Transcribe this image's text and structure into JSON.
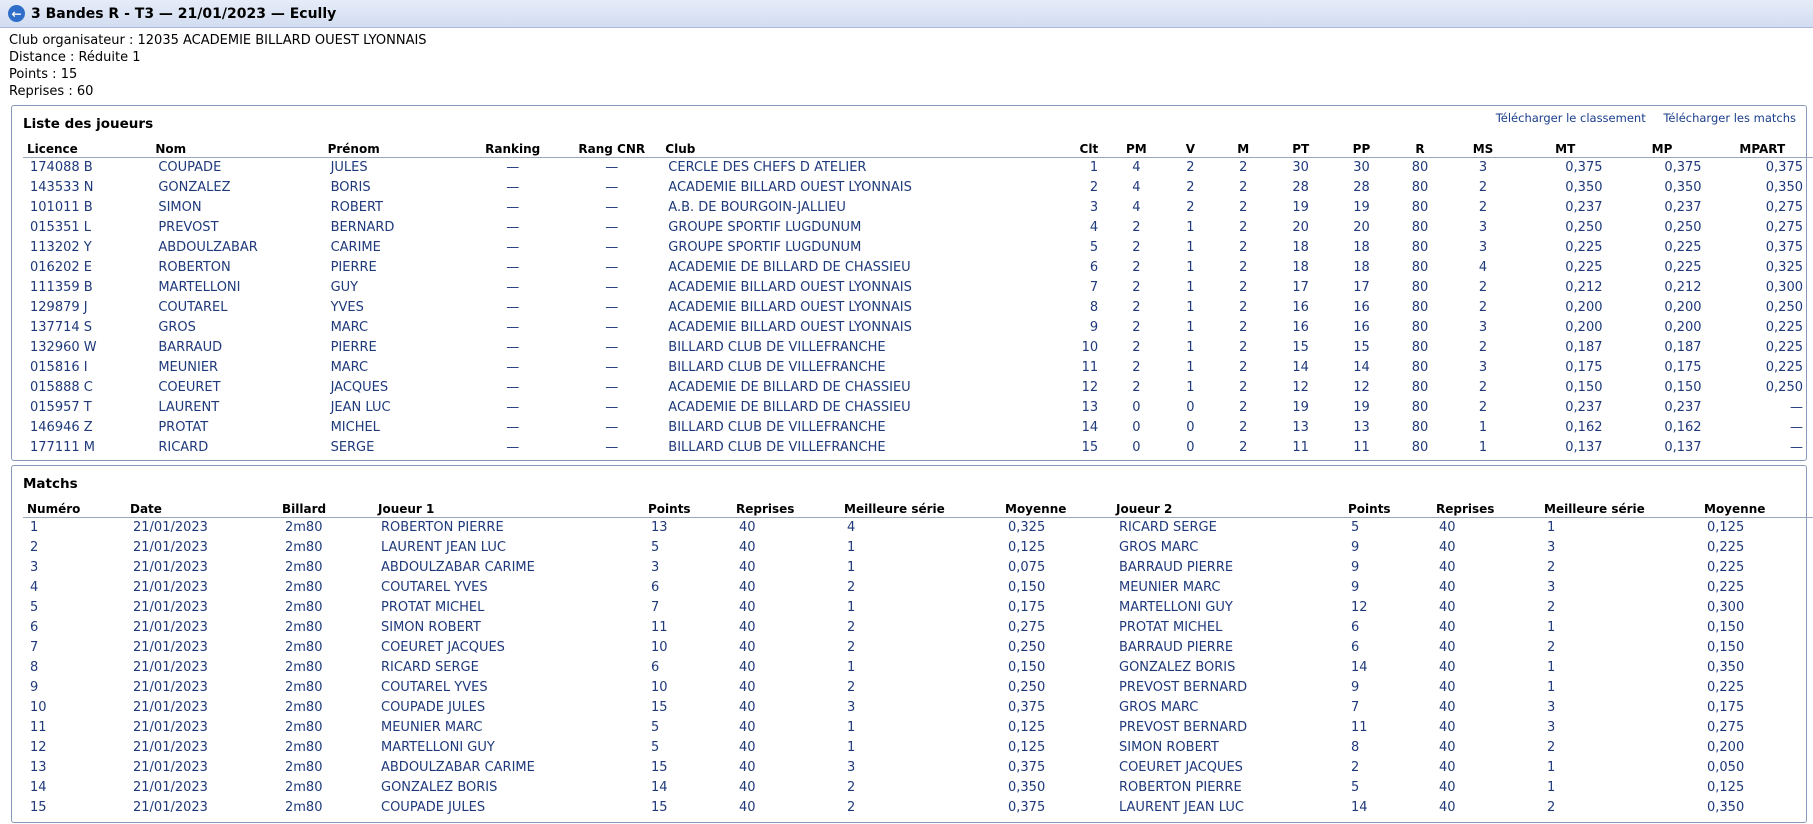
{
  "header": {
    "title": "3 Bandes R - T3 — 21/01/2023 — Ecully"
  },
  "info": [
    "Club organisateur : 12035 ACADEMIE BILLARD OUEST LYONNAIS",
    "Distance : Réduite 1",
    "Points : 15",
    "Reprises : 60"
  ],
  "players": {
    "title": "Liste des joueurs",
    "download_ranking": "Télécharger le classement",
    "download_matches": "Télécharger les matchs",
    "columns": [
      "Licence",
      "Nom",
      "Prénom",
      "Ranking",
      "Rang CNR",
      "Club",
      "Clt",
      "PM",
      "V",
      "M",
      "PT",
      "PP",
      "R",
      "MS",
      "MT",
      "MP",
      "MPART"
    ],
    "rows": [
      [
        "174088 B",
        "COUPADE",
        "JULES",
        "—",
        "—",
        "CERCLE DES CHEFS D ATELIER",
        "1",
        "4",
        "2",
        "2",
        "30",
        "30",
        "80",
        "3",
        "0,375",
        "0,375",
        "0,375"
      ],
      [
        "143533 N",
        "GONZALEZ",
        "BORIS",
        "—",
        "—",
        "ACADEMIE BILLARD OUEST LYONNAIS",
        "2",
        "4",
        "2",
        "2",
        "28",
        "28",
        "80",
        "2",
        "0,350",
        "0,350",
        "0,350"
      ],
      [
        "101011 B",
        "SIMON",
        "ROBERT",
        "—",
        "—",
        "A.B. DE BOURGOIN-JALLIEU",
        "3",
        "4",
        "2",
        "2",
        "19",
        "19",
        "80",
        "2",
        "0,237",
        "0,237",
        "0,275"
      ],
      [
        "015351 L",
        "PREVOST",
        "BERNARD",
        "—",
        "—",
        "GROUPE SPORTIF LUGDUNUM",
        "4",
        "2",
        "1",
        "2",
        "20",
        "20",
        "80",
        "3",
        "0,250",
        "0,250",
        "0,275"
      ],
      [
        "113202 Y",
        "ABDOULZABAR",
        "CARIME",
        "—",
        "—",
        "GROUPE SPORTIF LUGDUNUM",
        "5",
        "2",
        "1",
        "2",
        "18",
        "18",
        "80",
        "3",
        "0,225",
        "0,225",
        "0,375"
      ],
      [
        "016202 E",
        "ROBERTON",
        "PIERRE",
        "—",
        "—",
        "ACADEMIE DE BILLARD DE CHASSIEU",
        "6",
        "2",
        "1",
        "2",
        "18",
        "18",
        "80",
        "4",
        "0,225",
        "0,225",
        "0,325"
      ],
      [
        "111359 B",
        "MARTELLONI",
        "GUY",
        "—",
        "—",
        "ACADEMIE BILLARD OUEST LYONNAIS",
        "7",
        "2",
        "1",
        "2",
        "17",
        "17",
        "80",
        "2",
        "0,212",
        "0,212",
        "0,300"
      ],
      [
        "129879 J",
        "COUTAREL",
        "YVES",
        "—",
        "—",
        "ACADEMIE BILLARD OUEST LYONNAIS",
        "8",
        "2",
        "1",
        "2",
        "16",
        "16",
        "80",
        "2",
        "0,200",
        "0,200",
        "0,250"
      ],
      [
        "137714 S",
        "GROS",
        "MARC",
        "—",
        "—",
        "ACADEMIE BILLARD OUEST LYONNAIS",
        "9",
        "2",
        "1",
        "2",
        "16",
        "16",
        "80",
        "3",
        "0,200",
        "0,200",
        "0,225"
      ],
      [
        "132960 W",
        "BARRAUD",
        "PIERRE",
        "—",
        "—",
        "BILLARD CLUB DE VILLEFRANCHE",
        "10",
        "2",
        "1",
        "2",
        "15",
        "15",
        "80",
        "2",
        "0,187",
        "0,187",
        "0,225"
      ],
      [
        "015816 I",
        "MEUNIER",
        "MARC",
        "—",
        "—",
        "BILLARD CLUB DE VILLEFRANCHE",
        "11",
        "2",
        "1",
        "2",
        "14",
        "14",
        "80",
        "3",
        "0,175",
        "0,175",
        "0,225"
      ],
      [
        "015888 C",
        "COEURET",
        "JACQUES",
        "—",
        "—",
        "ACADEMIE DE BILLARD DE CHASSIEU",
        "12",
        "2",
        "1",
        "2",
        "12",
        "12",
        "80",
        "2",
        "0,150",
        "0,150",
        "0,250"
      ],
      [
        "015957 T",
        "LAURENT",
        "JEAN LUC",
        "—",
        "—",
        "ACADEMIE DE BILLARD DE CHASSIEU",
        "13",
        "0",
        "0",
        "2",
        "19",
        "19",
        "80",
        "2",
        "0,237",
        "0,237",
        "—"
      ],
      [
        "146946 Z",
        "PROTAT",
        "MICHEL",
        "—",
        "—",
        "BILLARD CLUB DE VILLEFRANCHE",
        "14",
        "0",
        "0",
        "2",
        "13",
        "13",
        "80",
        "1",
        "0,162",
        "0,162",
        "—"
      ],
      [
        "177111 M",
        "RICARD",
        "SERGE",
        "—",
        "—",
        "BILLARD CLUB DE VILLEFRANCHE",
        "15",
        "0",
        "0",
        "2",
        "11",
        "11",
        "80",
        "1",
        "0,137",
        "0,137",
        "—"
      ]
    ]
  },
  "matches": {
    "title": "Matchs",
    "columns": [
      "Numéro",
      "Date",
      "Billard",
      "Joueur 1",
      "Points",
      "Reprises",
      "Meilleure série",
      "Moyenne",
      "Joueur 2",
      "Points",
      "Reprises",
      "Meilleure série",
      "Moyenne"
    ],
    "rows": [
      [
        "1",
        "21/01/2023",
        "2m80",
        "ROBERTON PIERRE",
        "13",
        "40",
        "4",
        "0,325",
        "RICARD SERGE",
        "5",
        "40",
        "1",
        "0,125"
      ],
      [
        "2",
        "21/01/2023",
        "2m80",
        "LAURENT JEAN LUC",
        "5",
        "40",
        "1",
        "0,125",
        "GROS MARC",
        "9",
        "40",
        "3",
        "0,225"
      ],
      [
        "3",
        "21/01/2023",
        "2m80",
        "ABDOULZABAR CARIME",
        "3",
        "40",
        "1",
        "0,075",
        "BARRAUD PIERRE",
        "9",
        "40",
        "2",
        "0,225"
      ],
      [
        "4",
        "21/01/2023",
        "2m80",
        "COUTAREL YVES",
        "6",
        "40",
        "2",
        "0,150",
        "MEUNIER MARC",
        "9",
        "40",
        "3",
        "0,225"
      ],
      [
        "5",
        "21/01/2023",
        "2m80",
        "PROTAT MICHEL",
        "7",
        "40",
        "1",
        "0,175",
        "MARTELLONI GUY",
        "12",
        "40",
        "2",
        "0,300"
      ],
      [
        "6",
        "21/01/2023",
        "2m80",
        "SIMON ROBERT",
        "11",
        "40",
        "2",
        "0,275",
        "PROTAT MICHEL",
        "6",
        "40",
        "1",
        "0,150"
      ],
      [
        "7",
        "21/01/2023",
        "2m80",
        "COEURET JACQUES",
        "10",
        "40",
        "2",
        "0,250",
        "BARRAUD PIERRE",
        "6",
        "40",
        "2",
        "0,150"
      ],
      [
        "8",
        "21/01/2023",
        "2m80",
        "RICARD SERGE",
        "6",
        "40",
        "1",
        "0,150",
        "GONZALEZ BORIS",
        "14",
        "40",
        "1",
        "0,350"
      ],
      [
        "9",
        "21/01/2023",
        "2m80",
        "COUTAREL YVES",
        "10",
        "40",
        "2",
        "0,250",
        "PREVOST BERNARD",
        "9",
        "40",
        "1",
        "0,225"
      ],
      [
        "10",
        "21/01/2023",
        "2m80",
        "COUPADE JULES",
        "15",
        "40",
        "3",
        "0,375",
        "GROS MARC",
        "7",
        "40",
        "3",
        "0,175"
      ],
      [
        "11",
        "21/01/2023",
        "2m80",
        "MEUNIER MARC",
        "5",
        "40",
        "1",
        "0,125",
        "PREVOST BERNARD",
        "11",
        "40",
        "3",
        "0,275"
      ],
      [
        "12",
        "21/01/2023",
        "2m80",
        "MARTELLONI GUY",
        "5",
        "40",
        "1",
        "0,125",
        "SIMON ROBERT",
        "8",
        "40",
        "2",
        "0,200"
      ],
      [
        "13",
        "21/01/2023",
        "2m80",
        "ABDOULZABAR CARIME",
        "15",
        "40",
        "3",
        "0,375",
        "COEURET JACQUES",
        "2",
        "40",
        "1",
        "0,050"
      ],
      [
        "14",
        "21/01/2023",
        "2m80",
        "GONZALEZ BORIS",
        "14",
        "40",
        "2",
        "0,350",
        "ROBERTON PIERRE",
        "5",
        "40",
        "1",
        "0,125"
      ],
      [
        "15",
        "21/01/2023",
        "2m80",
        "COUPADE JULES",
        "15",
        "40",
        "2",
        "0,375",
        "LAURENT JEAN LUC",
        "14",
        "40",
        "2",
        "0,350"
      ]
    ]
  }
}
